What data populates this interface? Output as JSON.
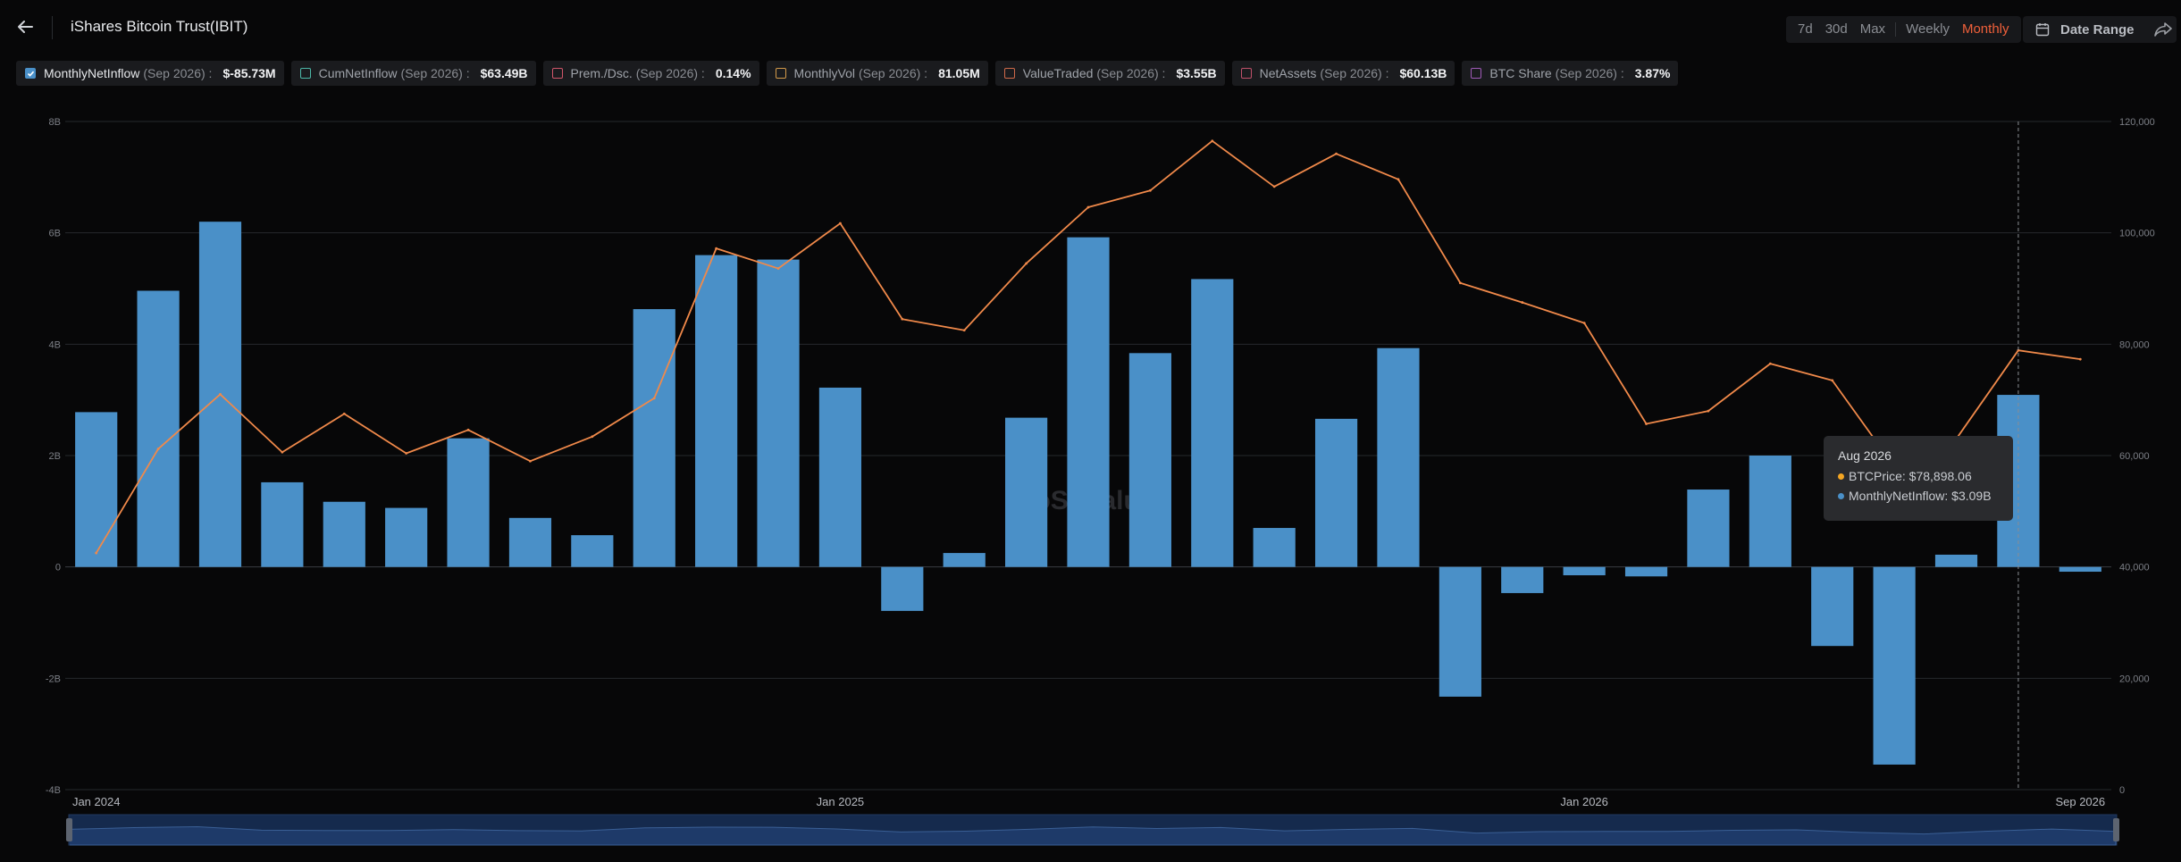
{
  "header": {
    "title": "iShares Bitcoin Trust(IBIT)",
    "ranges": [
      "7d",
      "30d",
      "Max"
    ],
    "intervals": [
      "Weekly",
      "Monthly"
    ],
    "active_interval": "Monthly",
    "date_range_label": "Date Range"
  },
  "legend": [
    {
      "name": "MonthlyNetInflow",
      "period": "(Sep 2026) :",
      "value": "$-85.73M",
      "color": "#4a90c8",
      "checked": true
    },
    {
      "name": "CumNetInflow",
      "period": "(Sep 2026) :",
      "value": "$63.49B",
      "color": "#4cb8a8",
      "checked": false
    },
    {
      "name": "Prem./Dsc.",
      "period": "(Sep 2026) :",
      "value": "0.14%",
      "color": "#d0566a",
      "checked": false
    },
    {
      "name": "MonthlyVol",
      "period": "(Sep 2026) :",
      "value": "81.05M",
      "color": "#d39a4a",
      "checked": false
    },
    {
      "name": "ValueTraded",
      "period": "(Sep 2026) :",
      "value": "$3.55B",
      "color": "#d06a4a",
      "checked": false
    },
    {
      "name": "NetAssets",
      "period": "(Sep 2026) :",
      "value": "$60.13B",
      "color": "#c0506a",
      "checked": false
    },
    {
      "name": "BTC Share",
      "period": "(Sep 2026) :",
      "value": "3.87%",
      "color": "#a05ab8",
      "checked": false
    }
  ],
  "tooltip": {
    "title": "Aug 2026",
    "rows": [
      {
        "label": "BTCPrice: $78,898.06",
        "color": "#f5a623"
      },
      {
        "label": "MonthlyNetInflow: $3.09B",
        "color": "#4a90c8"
      }
    ]
  },
  "watermark": "SoSoValue",
  "chart_data": {
    "type": "bar",
    "categories": [
      "Jan 2024",
      "Feb 2024",
      "Mar 2024",
      "Apr 2024",
      "May 2024",
      "Jun 2024",
      "Jul 2024",
      "Aug 2024",
      "Sep 2024",
      "Oct 2024",
      "Nov 2024",
      "Dec 2024",
      "Jan 2025",
      "Feb 2025",
      "Mar 2025",
      "Apr 2025",
      "May 2025",
      "Jun 2025",
      "Jul 2025",
      "Aug 2025",
      "Sep 2025",
      "Oct 2025",
      "Nov 2025",
      "Dec 2025",
      "Jan 2026",
      "Feb 2026",
      "Mar 2026",
      "Apr 2026",
      "May 2026",
      "Jun 2026",
      "Jul 2026",
      "Aug 2026",
      "Sep 2026"
    ],
    "x_tick_labels": [
      "Jan 2024",
      "Jan 2025",
      "Jan 2026",
      "Sep 2026"
    ],
    "series": [
      {
        "name": "MonthlyNetInflow",
        "type": "bar",
        "axis": "left",
        "color": "#4a90c8",
        "values": [
          2.78,
          4.96,
          6.2,
          1.52,
          1.17,
          1.06,
          2.31,
          0.88,
          0.57,
          4.63,
          5.6,
          5.52,
          3.22,
          -0.79,
          0.25,
          2.68,
          5.92,
          3.84,
          5.17,
          0.7,
          2.66,
          3.93,
          -2.33,
          -0.47,
          -0.15,
          -0.17,
          1.39,
          2.0,
          -1.42,
          -3.55,
          0.22,
          3.09,
          -0.086
        ]
      },
      {
        "name": "BTCPrice",
        "type": "line",
        "axis": "right",
        "color": "#f0894a",
        "values": [
          42500,
          61200,
          71000,
          60600,
          67500,
          60400,
          64600,
          59000,
          63400,
          70300,
          97200,
          93600,
          101700,
          84500,
          82500,
          94500,
          104600,
          107600,
          116500,
          108300,
          114200,
          109600,
          91000,
          87500,
          83800,
          65700,
          68000,
          76500,
          73500,
          58000,
          63000,
          78898.06,
          77300
        ]
      }
    ],
    "ylim": [
      -4,
      8
    ],
    "y_tick_labels": [
      "-4B",
      "-2B",
      "0",
      "2B",
      "4B",
      "6B",
      "8B"
    ],
    "y2lim": [
      0,
      120000
    ],
    "y2_tick_labels": [
      "0",
      "20,000",
      "40,000",
      "60,000",
      "80,000",
      "100,000",
      "120,000"
    ],
    "grid": true
  }
}
